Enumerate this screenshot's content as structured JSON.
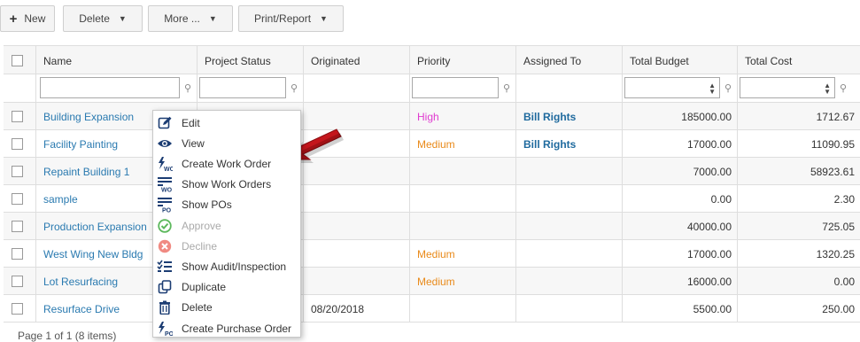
{
  "toolbar": {
    "new_label": "New",
    "delete_label": "Delete",
    "more_label": "More ...",
    "print_label": "Print/Report"
  },
  "columns": [
    "Name",
    "Project Status",
    "Originated",
    "Priority",
    "Assigned To",
    "Total Budget",
    "Total Cost"
  ],
  "rows": [
    {
      "name": "Building Expansion",
      "status": "",
      "originated": "",
      "priority": "High",
      "assigned": "Bill Rights",
      "budget": "185000.00",
      "cost": "1712.67"
    },
    {
      "name": "Facility Painting",
      "status": "",
      "originated": "",
      "priority": "Medium",
      "assigned": "Bill Rights",
      "budget": "17000.00",
      "cost": "11090.95"
    },
    {
      "name": "Repaint Building 1",
      "status": "",
      "originated": "",
      "priority": "",
      "assigned": "",
      "budget": "7000.00",
      "cost": "58923.61"
    },
    {
      "name": "sample",
      "status": "",
      "originated": "",
      "priority": "",
      "assigned": "",
      "budget": "0.00",
      "cost": "2.30"
    },
    {
      "name": "Production Expansion",
      "status": "",
      "originated": "",
      "priority": "",
      "assigned": "",
      "budget": "40000.00",
      "cost": "725.05"
    },
    {
      "name": "West Wing New Bldg",
      "status": "",
      "originated": "",
      "priority": "Medium",
      "assigned": "",
      "budget": "17000.00",
      "cost": "1320.25"
    },
    {
      "name": "Lot Resurfacing",
      "status": "",
      "originated": "",
      "priority": "Medium",
      "assigned": "",
      "budget": "16000.00",
      "cost": "0.00"
    },
    {
      "name": "Resurface Drive",
      "status": "",
      "originated": "08/20/2018",
      "priority": "",
      "assigned": "",
      "budget": "5500.00",
      "cost": "250.00"
    }
  ],
  "context_menu": [
    {
      "label": "Edit",
      "icon": "edit-icon",
      "disabled": false
    },
    {
      "label": "View",
      "icon": "eye-icon",
      "disabled": false
    },
    {
      "label": "Create Work Order",
      "icon": "create-work-order-icon",
      "disabled": false
    },
    {
      "label": "Show Work Orders",
      "icon": "work-orders-list-icon",
      "disabled": false
    },
    {
      "label": "Show POs",
      "icon": "po-list-icon",
      "disabled": false
    },
    {
      "label": "Approve",
      "icon": "approve-check-icon",
      "disabled": true
    },
    {
      "label": "Decline",
      "icon": "decline-x-icon",
      "disabled": true
    },
    {
      "label": "Show Audit/Inspection",
      "icon": "checklist-icon",
      "disabled": false
    },
    {
      "label": "Duplicate",
      "icon": "duplicate-icon",
      "disabled": false
    },
    {
      "label": "Delete",
      "icon": "trash-icon",
      "disabled": false
    },
    {
      "label": "Create Purchase Order",
      "icon": "create-po-icon",
      "disabled": false
    }
  ],
  "footer": {
    "pager_text": "Page 1 of 1 (8 items)"
  },
  "colors": {
    "link": "#2a7ab0",
    "high": "#e03bd0",
    "medium": "#e98a1a",
    "arrow": "#c4161c",
    "icon": "#1c3d73"
  }
}
